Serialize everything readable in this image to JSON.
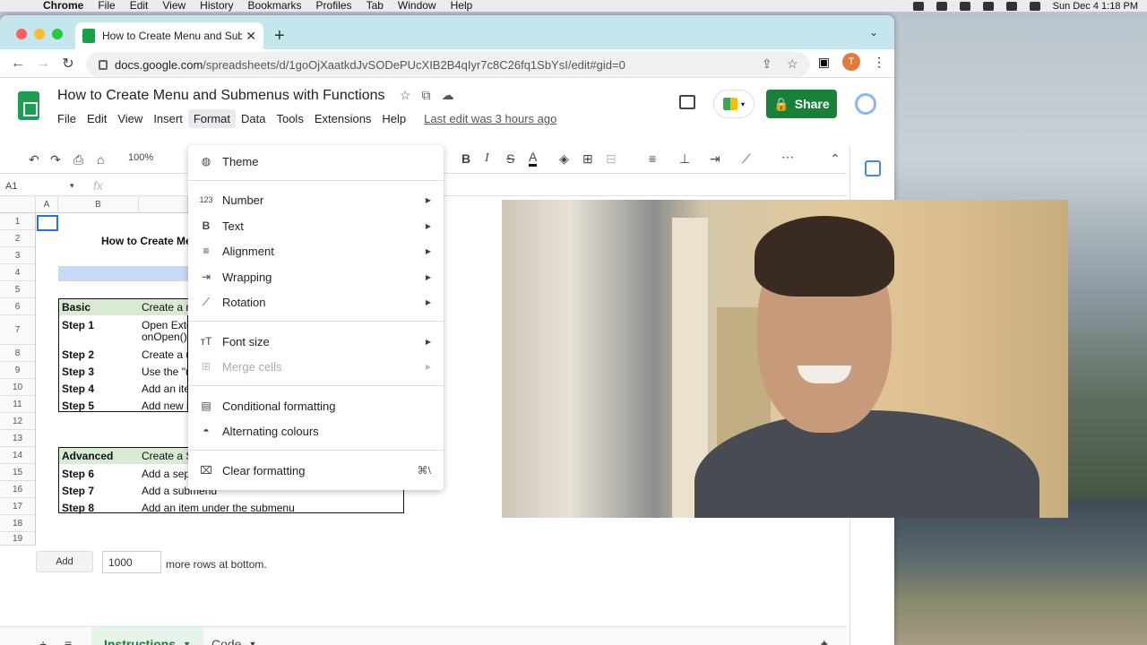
{
  "menubar": {
    "app": "Chrome",
    "items": [
      "File",
      "Edit",
      "View",
      "History",
      "Bookmarks",
      "Profiles",
      "Tab",
      "Window",
      "Help"
    ],
    "clock": "Sun Dec 4  1:18 PM"
  },
  "browser": {
    "tab_title": "How to Create Menu and Subm",
    "url_host": "docs.google.com",
    "url_path": "/spreadsheets/d/1goOjXaatkdJvSODePUcXIB2B4qIyr7c8C26fq1SbYsI/edit#gid=0",
    "avatar_letter": "T"
  },
  "sheets": {
    "doc_title": "How to Create Menu and Submenus with Functions",
    "menu": [
      "File",
      "Edit",
      "View",
      "Insert",
      "Format",
      "Data",
      "Tools",
      "Extensions",
      "Help"
    ],
    "last_edit": "Last edit was 3 hours ago",
    "share_label": "Share",
    "zoom": "100%",
    "name_box": "A1",
    "fx": "fx"
  },
  "grid": {
    "columns": [
      "A",
      "B"
    ],
    "rows": [
      "1",
      "2",
      "3",
      "4",
      "5",
      "6",
      "7",
      "8",
      "9",
      "10",
      "11",
      "12",
      "13",
      "14",
      "15",
      "16",
      "17",
      "18",
      "19"
    ],
    "title_cell": "How to Create Me",
    "basic_head": "Basic",
    "basic_head_b": "Create a r",
    "steps_basic": [
      {
        "step": "Step 1",
        "desc": "Open Exte",
        "desc2": "onOpen()"
      },
      {
        "step": "Step 2",
        "desc": "Create a u"
      },
      {
        "step": "Step 3",
        "desc": "Use the \"u"
      },
      {
        "step": "Step 4",
        "desc": "Add an ite"
      },
      {
        "step": "Step 5",
        "desc": "Add new i"
      }
    ],
    "advanced_head": "Advanced",
    "advanced_head_b": "Create a S",
    "steps_adv": [
      {
        "step": "Step 6",
        "desc": "Add a sep"
      },
      {
        "step": "Step 7",
        "desc": "Add a submenu"
      },
      {
        "step": "Step 8",
        "desc": "Add an item under the submenu"
      }
    ]
  },
  "add_rows": {
    "button": "Add",
    "count": "1000",
    "suffix": "more rows at bottom."
  },
  "sheet_tabs": [
    "Instructions",
    "Code"
  ],
  "format_menu": {
    "items": [
      {
        "label": "Theme",
        "icon": "palette-icon"
      },
      {
        "label": "Number",
        "icon": "number-icon",
        "submenu": true
      },
      {
        "label": "Text",
        "icon": "bold-icon",
        "submenu": true
      },
      {
        "label": "Alignment",
        "icon": "align-icon",
        "submenu": true
      },
      {
        "label": "Wrapping",
        "icon": "wrap-icon",
        "submenu": true
      },
      {
        "label": "Rotation",
        "icon": "rotate-icon",
        "submenu": true
      },
      {
        "label": "Font size",
        "icon": "font-size-icon",
        "submenu": true
      },
      {
        "label": "Merge cells",
        "icon": "merge-icon",
        "submenu": true,
        "disabled": true
      },
      {
        "label": "Conditional formatting",
        "icon": "paint-roller-icon"
      },
      {
        "label": "Alternating colours",
        "icon": "fill-drop-icon"
      },
      {
        "label": "Clear formatting",
        "icon": "clear-format-icon",
        "shortcut": "⌘\\"
      }
    ]
  },
  "colors": {
    "accent": "#188038",
    "tab_strip": "#c6e6ee",
    "header_green": "#d9ead3"
  }
}
